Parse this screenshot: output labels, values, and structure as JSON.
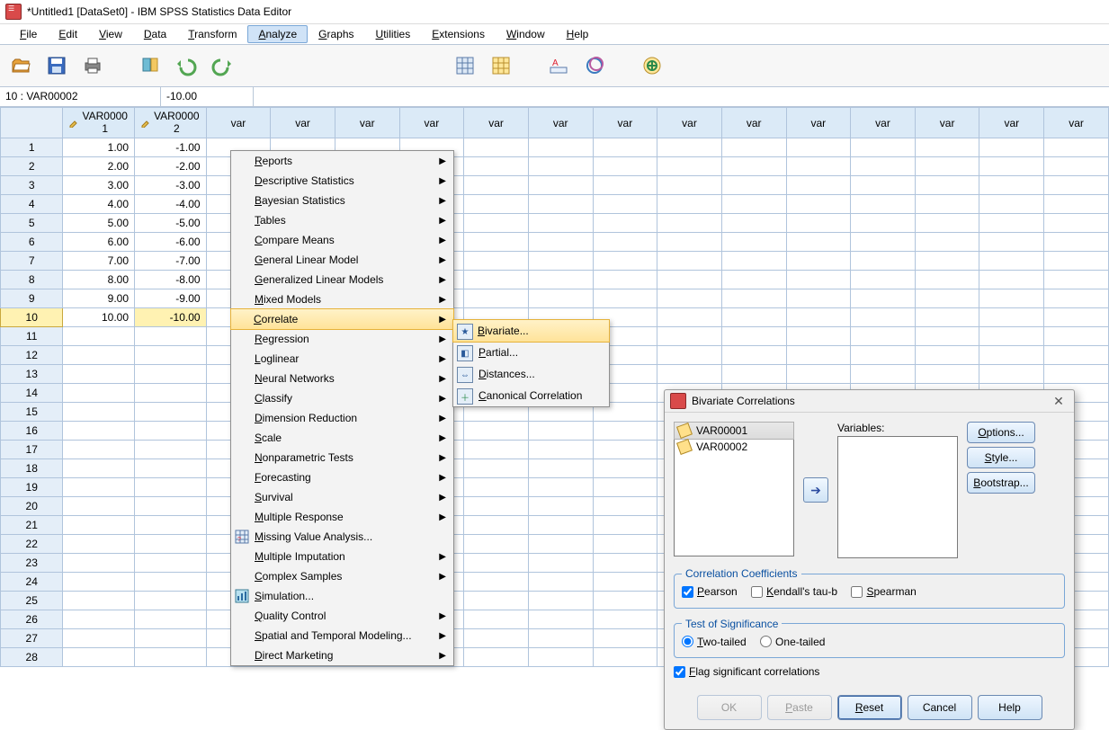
{
  "window": {
    "title": "*Untitled1 [DataSet0] - IBM SPSS Statistics Data Editor"
  },
  "menubar": {
    "items": [
      "File",
      "Edit",
      "View",
      "Data",
      "Transform",
      "Analyze",
      "Graphs",
      "Utilities",
      "Extensions",
      "Window",
      "Help"
    ],
    "active_index": 5
  },
  "cell_ref": {
    "name": "10 : VAR00002",
    "value": "-10.00"
  },
  "columns": {
    "var1": "VAR00001",
    "var2": "VAR00002",
    "blank_label": "var"
  },
  "data": {
    "rows": [
      {
        "n": "1",
        "v1": "1.00",
        "v2": "-1.00"
      },
      {
        "n": "2",
        "v1": "2.00",
        "v2": "-2.00"
      },
      {
        "n": "3",
        "v1": "3.00",
        "v2": "-3.00"
      },
      {
        "n": "4",
        "v1": "4.00",
        "v2": "-4.00"
      },
      {
        "n": "5",
        "v1": "5.00",
        "v2": "-5.00"
      },
      {
        "n": "6",
        "v1": "6.00",
        "v2": "-6.00"
      },
      {
        "n": "7",
        "v1": "7.00",
        "v2": "-7.00"
      },
      {
        "n": "8",
        "v1": "8.00",
        "v2": "-8.00"
      },
      {
        "n": "9",
        "v1": "9.00",
        "v2": "-9.00"
      },
      {
        "n": "10",
        "v1": "10.00",
        "v2": "-10.00"
      }
    ],
    "extra_rows": [
      "11",
      "12",
      "13",
      "14",
      "15",
      "16",
      "17",
      "18",
      "19",
      "20",
      "21",
      "22",
      "23",
      "24",
      "25",
      "26",
      "27",
      "28"
    ],
    "selected_row_index": 9
  },
  "analyze_menu": {
    "items": [
      {
        "label": "Reports",
        "sub": true
      },
      {
        "label": "Descriptive Statistics",
        "sub": true
      },
      {
        "label": "Bayesian Statistics",
        "sub": true
      },
      {
        "label": "Tables",
        "sub": true
      },
      {
        "label": "Compare Means",
        "sub": true
      },
      {
        "label": "General Linear Model",
        "sub": true
      },
      {
        "label": "Generalized Linear Models",
        "sub": true
      },
      {
        "label": "Mixed Models",
        "sub": true
      },
      {
        "label": "Correlate",
        "sub": true,
        "hl": true
      },
      {
        "label": "Regression",
        "sub": true
      },
      {
        "label": "Loglinear",
        "sub": true
      },
      {
        "label": "Neural Networks",
        "sub": true
      },
      {
        "label": "Classify",
        "sub": true
      },
      {
        "label": "Dimension Reduction",
        "sub": true
      },
      {
        "label": "Scale",
        "sub": true
      },
      {
        "label": "Nonparametric Tests",
        "sub": true
      },
      {
        "label": "Forecasting",
        "sub": true
      },
      {
        "label": "Survival",
        "sub": true
      },
      {
        "label": "Multiple Response",
        "sub": true
      },
      {
        "label": "Missing Value Analysis...",
        "sub": false,
        "icon": "grid"
      },
      {
        "label": "Multiple Imputation",
        "sub": true
      },
      {
        "label": "Complex Samples",
        "sub": true
      },
      {
        "label": "Simulation...",
        "sub": false,
        "icon": "sim"
      },
      {
        "label": "Quality Control",
        "sub": true
      },
      {
        "label": "Spatial and Temporal Modeling...",
        "sub": true
      },
      {
        "label": "Direct Marketing",
        "sub": true
      }
    ]
  },
  "correlate_submenu": {
    "items": [
      {
        "label": "Bivariate...",
        "icon": "bivicon",
        "hl": true
      },
      {
        "label": "Partial...",
        "icon": "particon"
      },
      {
        "label": "Distances...",
        "icon": "disticon"
      },
      {
        "label": "Canonical Correlation",
        "icon": "canonicon"
      }
    ]
  },
  "dialog": {
    "title": "Bivariate Correlations",
    "source_list": [
      "VAR00001",
      "VAR00002"
    ],
    "selected_source_index": 0,
    "vars_label": "Variables:",
    "side_buttons": [
      "Options...",
      "Style...",
      "Bootstrap..."
    ],
    "group_corr": {
      "legend": "Correlation Coefficients",
      "pearson": "Pearson",
      "pearson_checked": true,
      "kendall": "Kendall's tau-b",
      "kendall_checked": false,
      "spearman": "Spearman",
      "spearman_checked": false
    },
    "group_sig": {
      "legend": "Test of Significance",
      "two": "Two-tailed",
      "two_checked": true,
      "one": "One-tailed",
      "one_checked": false
    },
    "flag": {
      "label": "Flag significant correlations",
      "checked": true
    },
    "buttons": {
      "ok": "OK",
      "paste": "Paste",
      "reset": "Reset",
      "cancel": "Cancel",
      "help": "Help"
    }
  }
}
